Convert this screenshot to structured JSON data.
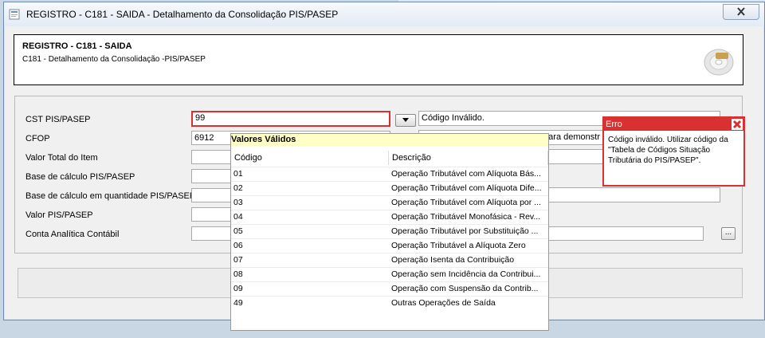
{
  "window": {
    "title": "REGISTRO - C181 - SAIDA - Detalhamento da Consolidação PIS/PASEP"
  },
  "header": {
    "title": "REGISTRO - C181 - SAIDA",
    "subtitle": "C181 - Detalhamento da Consolidação -PIS/PASEP"
  },
  "form": {
    "cst": {
      "label": "CST PIS/PASEP",
      "value": "99",
      "description": "Código Inválido."
    },
    "cfop": {
      "label": "CFOP",
      "value": "6912",
      "description": "para demonstr"
    },
    "valor_total": {
      "label": "Valor Total do Item",
      "value": ""
    },
    "base_calculo": {
      "label": "Base de cálculo PIS/PASEP",
      "value": ""
    },
    "base_quantidade": {
      "label": "Base de cálculo em quantidade PIS/PASEP",
      "value": ""
    },
    "valor_pis": {
      "label": "Valor PIS/PASEP",
      "value": ""
    },
    "conta": {
      "label": "Conta Analítica Contábil",
      "value": "",
      "button": "..."
    }
  },
  "popup": {
    "title": "Valores Válidos",
    "columns": [
      "Código",
      "Descrição"
    ],
    "rows": [
      {
        "code": "01",
        "desc": "Operação Tributável com Alíquota Bás..."
      },
      {
        "code": "02",
        "desc": "Operação Tributável com Alíquota Dife..."
      },
      {
        "code": "03",
        "desc": "Operação Tributável com Alíquota por ..."
      },
      {
        "code": "04",
        "desc": "Operação Tributável Monofásica - Rev..."
      },
      {
        "code": "05",
        "desc": "Operação Tributável por Substituição ..."
      },
      {
        "code": "06",
        "desc": "Operação Tributável a Alíquota Zero"
      },
      {
        "code": "07",
        "desc": "Operação Isenta da Contribuição"
      },
      {
        "code": "08",
        "desc": "Operação sem Incidência da Contribui..."
      },
      {
        "code": "09",
        "desc": "Operação com Suspensão da Contrib..."
      },
      {
        "code": "49",
        "desc": "Outras Operações de Saída"
      }
    ]
  },
  "error": {
    "title": "Erro",
    "message": "Código inválido. Utilizar código da \"Tabela de Códigos Situação Tributária do PIS/PASEP\"."
  },
  "colors": {
    "error": "#d93030",
    "popup_title_bg": "#ffffc6"
  },
  "icons": {
    "title": "app-icon",
    "close": "close-icon",
    "header": "cd-disc-icon",
    "dropdown": "chevron-down-icon",
    "error_close": "error-close-icon"
  }
}
